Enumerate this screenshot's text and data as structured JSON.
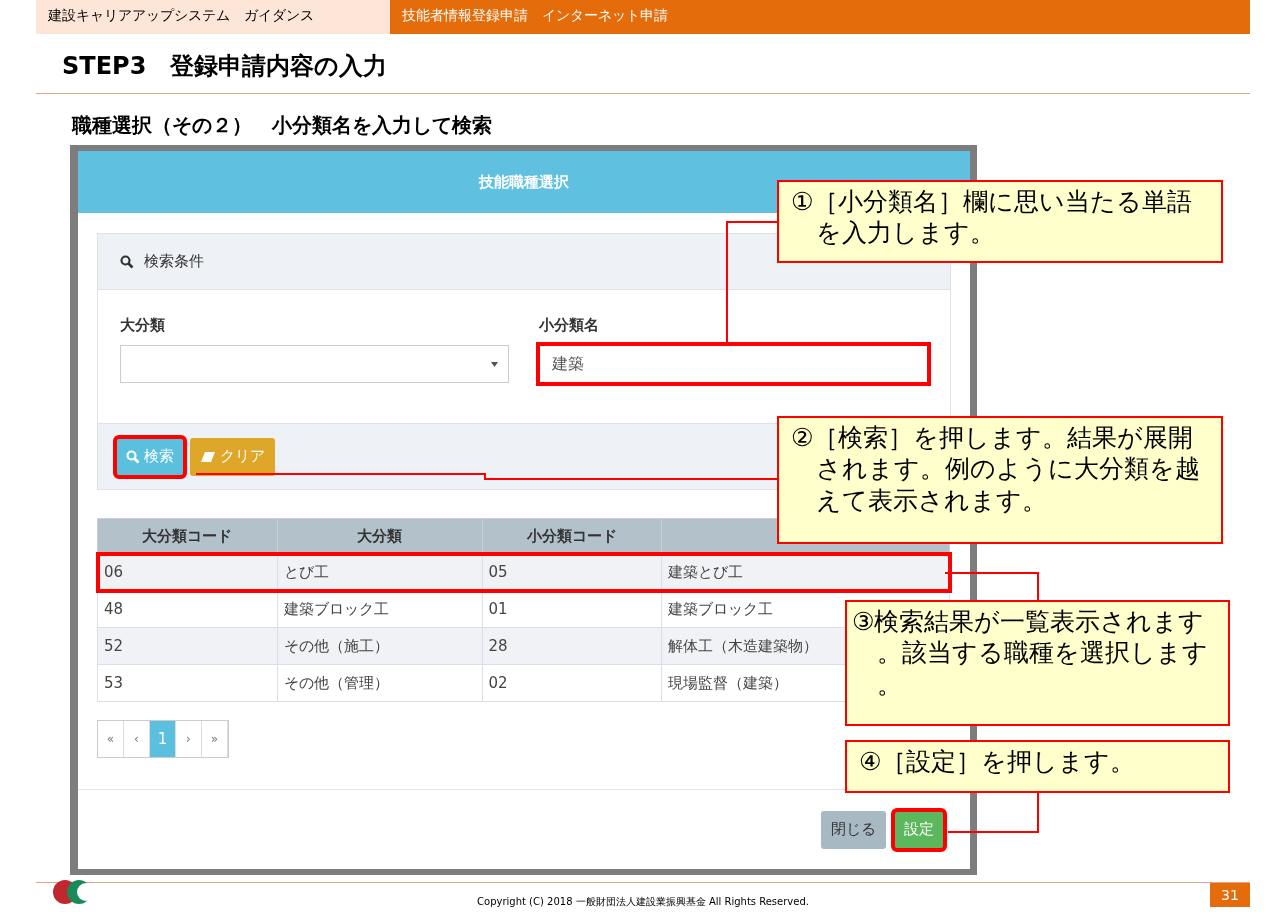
{
  "header": {
    "guide_title": "建設キャリアアップシステム　ガイダンス",
    "section": "技能者情報登録申請　インターネット申請"
  },
  "title": "STEP3　登録申請内容の入力",
  "subtitle": "職種選択（その２）　小分類名を入力して検索",
  "dialog": {
    "title": "技能職種選択",
    "panel_heading": "検索条件",
    "fields": [
      {
        "kind": "select",
        "label": "大分類"
      },
      {
        "kind": "text",
        "label": "小分類名",
        "value": "建築",
        "highlighted": true
      }
    ],
    "buttons": [
      {
        "kind": "search",
        "label": "検索",
        "highlighted": true
      },
      {
        "kind": "clear",
        "label": "クリア",
        "highlighted": false
      }
    ],
    "table": {
      "columns": [
        "大分類コード",
        "大分類",
        "小分類コード"
      ],
      "rows": [
        {
          "cells": [
            "06",
            "とび工",
            "05",
            "建築とび工"
          ],
          "selected": true
        },
        {
          "cells": [
            "48",
            "建築ブロック工",
            "01",
            "建築ブロック工"
          ],
          "selected": false
        },
        {
          "cells": [
            "52",
            "その他（施工）",
            "28",
            "解体工（木造建築物）"
          ],
          "selected": false
        },
        {
          "cells": [
            "53",
            "その他（管理）",
            "02",
            "現場監督（建築）"
          ],
          "selected": false
        }
      ]
    },
    "pagination": [
      {
        "label": "«",
        "selected": false
      },
      {
        "label": "‹",
        "selected": false
      },
      {
        "label": "1",
        "selected": true
      },
      {
        "label": "›",
        "selected": false
      },
      {
        "label": "»",
        "selected": false
      }
    ],
    "footer_buttons": [
      {
        "kind": "close",
        "label": "閉じる",
        "highlighted": false
      },
      {
        "kind": "ok",
        "label": "設定",
        "highlighted": true
      }
    ]
  },
  "callouts": [
    "①［小分類名］欄に思い当たる単語を入力します。",
    "②［検索］を押します。結果が展開されます。例のように大分類を越えて表示されます。",
    "③検索結果が一覧表示されます。該当する職種を選択します。",
    "④［設定］を押します。"
  ],
  "footer": {
    "copyright": "Copyright (C) 2018 一般財団法人建設業振興基金 All Rights Reserved.",
    "page": "31"
  }
}
